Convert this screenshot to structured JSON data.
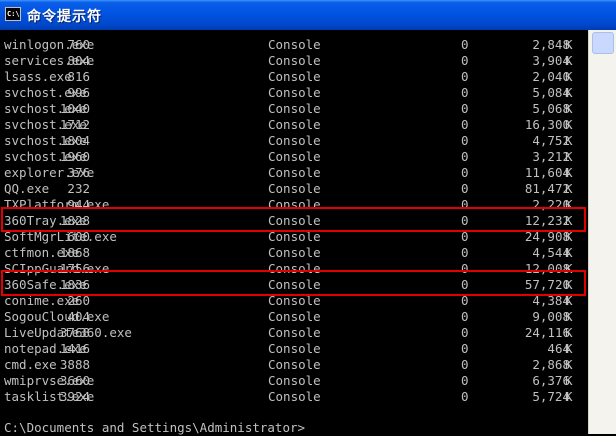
{
  "window": {
    "title": "命令提示符",
    "icon_label": "C:\\"
  },
  "processes": [
    {
      "name": "winlogon.exe",
      "pid": "760",
      "session": "Console",
      "num": "0",
      "mem": "2,848",
      "unit": "K"
    },
    {
      "name": "services.exe",
      "pid": "804",
      "session": "Console",
      "num": "0",
      "mem": "3,904",
      "unit": "K"
    },
    {
      "name": "lsass.exe",
      "pid": "816",
      "session": "Console",
      "num": "0",
      "mem": "2,040",
      "unit": "K"
    },
    {
      "name": "svchost.exe",
      "pid": "996",
      "session": "Console",
      "num": "0",
      "mem": "5,084",
      "unit": "K"
    },
    {
      "name": "svchost.exe",
      "pid": "1040",
      "session": "Console",
      "num": "0",
      "mem": "5,068",
      "unit": "K"
    },
    {
      "name": "svchost.exe",
      "pid": "1712",
      "session": "Console",
      "num": "0",
      "mem": "16,300",
      "unit": "K"
    },
    {
      "name": "svchost.exe",
      "pid": "1804",
      "session": "Console",
      "num": "0",
      "mem": "4,752",
      "unit": "K"
    },
    {
      "name": "svchost.exe",
      "pid": "1960",
      "session": "Console",
      "num": "0",
      "mem": "3,212",
      "unit": "K"
    },
    {
      "name": "explorer.exe",
      "pid": "376",
      "session": "Console",
      "num": "0",
      "mem": "11,604",
      "unit": "K"
    },
    {
      "name": "QQ.exe",
      "pid": "232",
      "session": "Console",
      "num": "0",
      "mem": "81,472",
      "unit": "K"
    },
    {
      "name": "TXPlatform.exe",
      "pid": "944",
      "session": "Console",
      "num": "0",
      "mem": "2,220",
      "unit": "K"
    },
    {
      "name": "360Tray.exe",
      "pid": "1828",
      "session": "Console",
      "num": "0",
      "mem": "12,232",
      "unit": "K"
    },
    {
      "name": "SoftMgrLite.exe",
      "pid": "600",
      "session": "Console",
      "num": "0",
      "mem": "24,908",
      "unit": "K"
    },
    {
      "name": "ctfmon.exe",
      "pid": "1868",
      "session": "Console",
      "num": "0",
      "mem": "4,544",
      "unit": "K"
    },
    {
      "name": "SCIppGuard.exe",
      "pid": "1756",
      "session": "Console",
      "num": "0",
      "mem": "12,008",
      "unit": "K"
    },
    {
      "name": "360Safe.exe",
      "pid": "1836",
      "session": "Console",
      "num": "0",
      "mem": "57,720",
      "unit": "K"
    },
    {
      "name": "conime.exe",
      "pid": "260",
      "session": "Console",
      "num": "0",
      "mem": "4,384",
      "unit": "K"
    },
    {
      "name": "SogouCloud.exe",
      "pid": "404",
      "session": "Console",
      "num": "0",
      "mem": "9,008",
      "unit": "K"
    },
    {
      "name": "LiveUpdate360.exe",
      "pid": "3768",
      "session": "Console",
      "num": "0",
      "mem": "24,116",
      "unit": "K"
    },
    {
      "name": "notepad.exe",
      "pid": "1416",
      "session": "Console",
      "num": "0",
      "mem": "464",
      "unit": "K"
    },
    {
      "name": "cmd.exe",
      "pid": "3888",
      "session": "Console",
      "num": "0",
      "mem": "2,868",
      "unit": "K"
    },
    {
      "name": "wmiprvse.exe",
      "pid": "3660",
      "session": "Console",
      "num": "0",
      "mem": "6,376",
      "unit": "K"
    },
    {
      "name": "tasklist.exe",
      "pid": "3924",
      "session": "Console",
      "num": "0",
      "mem": "5,724",
      "unit": "K"
    }
  ],
  "prompt": "C:\\Documents and Settings\\Administrator>",
  "highlight_color": "#e00000"
}
